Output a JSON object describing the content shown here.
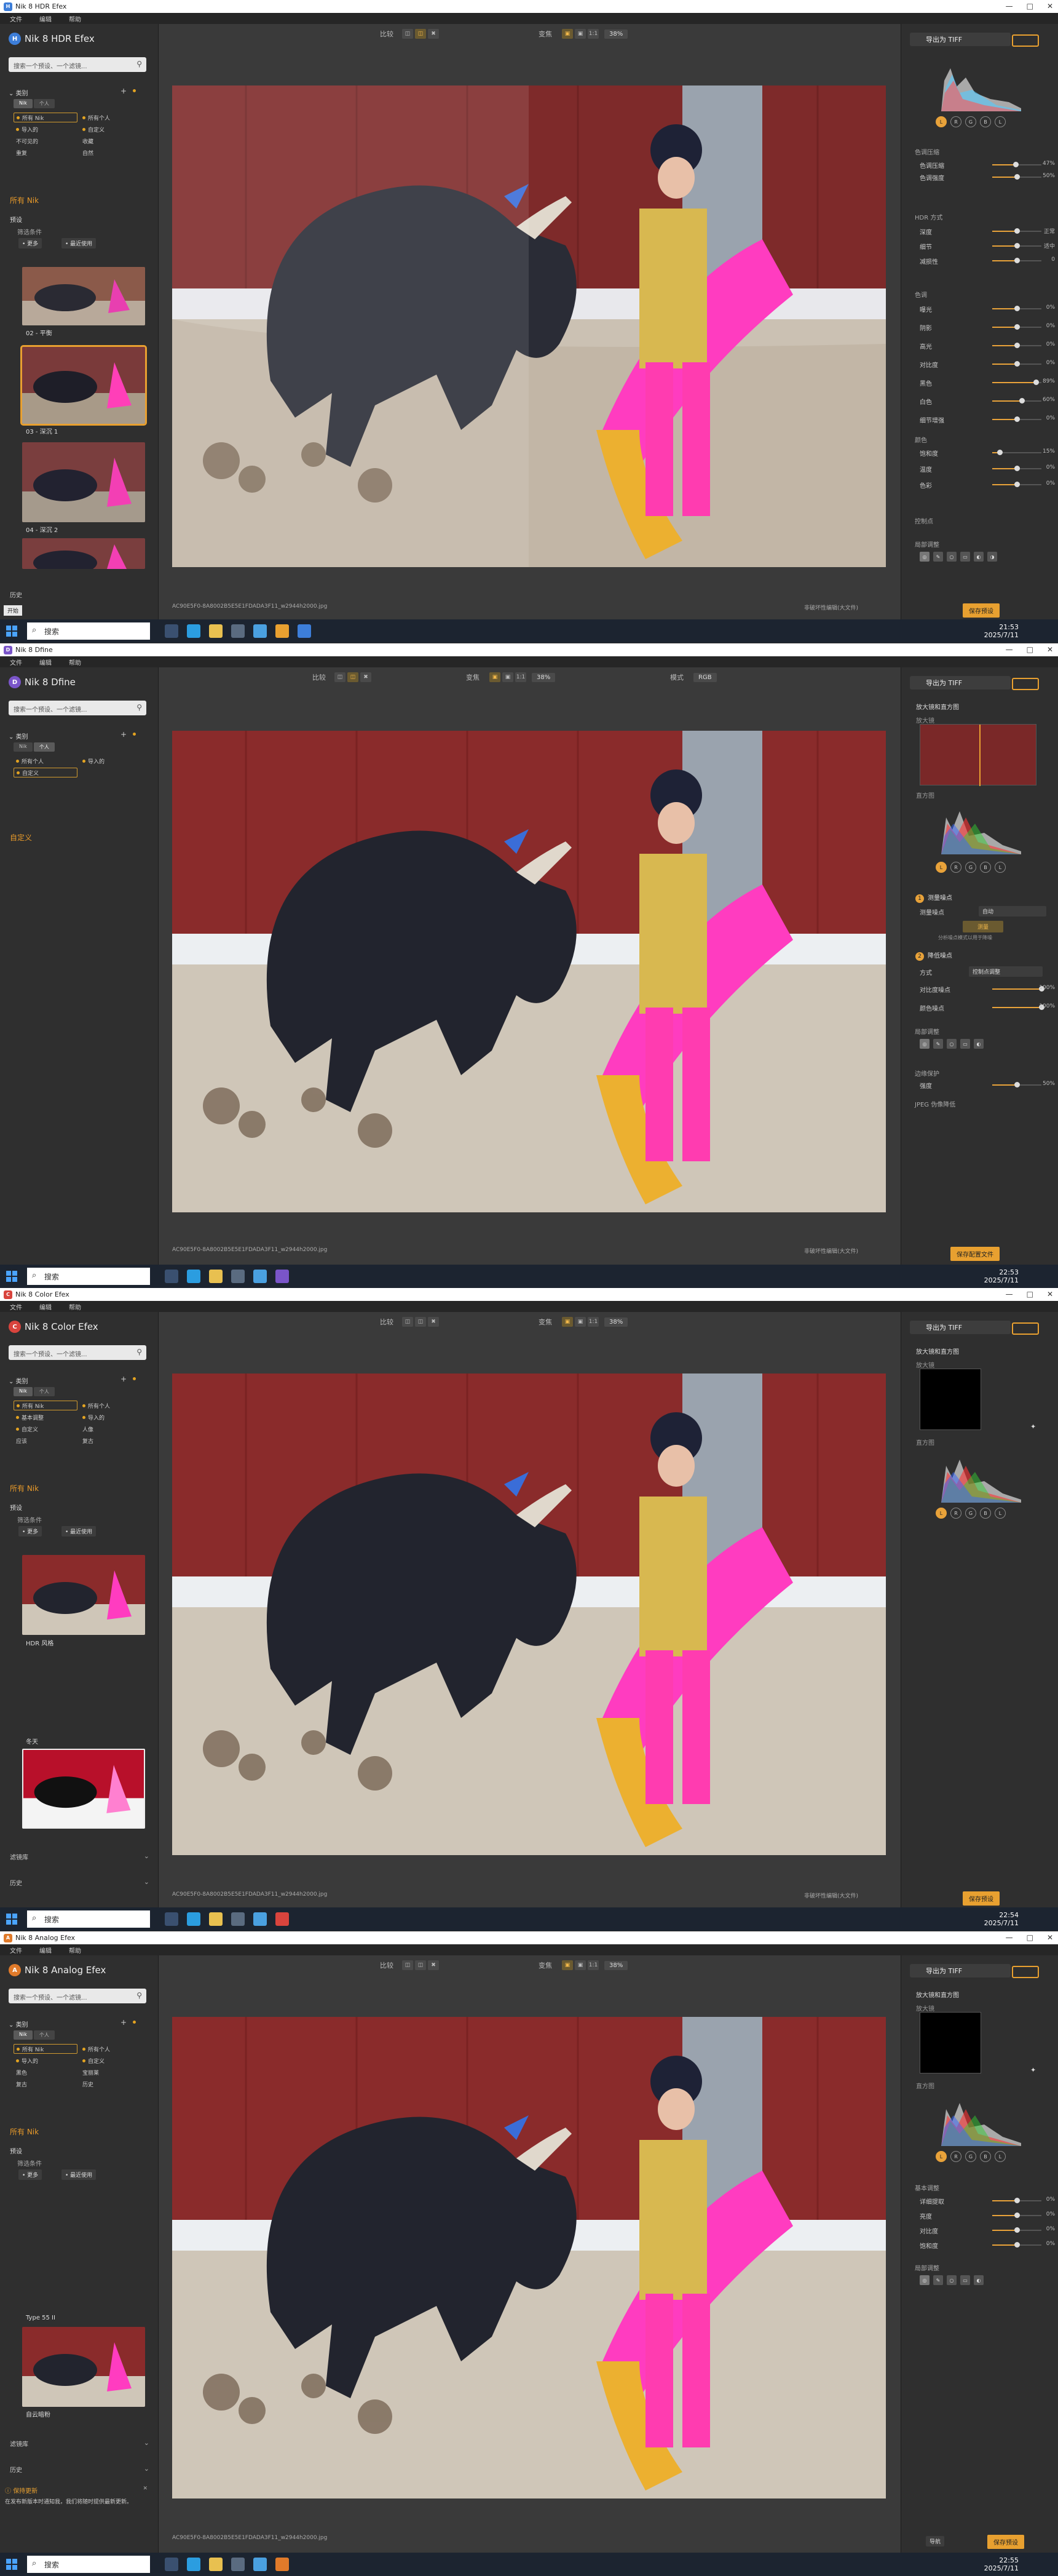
{
  "menu": [
    "文件",
    "编辑",
    "帮助"
  ],
  "search_placeholder": "搜索一个预设、一个滤镜...",
  "common": {
    "compare_label": "比较",
    "view_label": "变焦",
    "zoom_value": "38%",
    "ratio_label": "1:1",
    "export_label": "导出为 TIFF",
    "seg_nik": "Nik",
    "seg_personal": "个人",
    "taskbar_search": "搜索",
    "nondestructive": "非破坏性编辑(大文件)",
    "filename": "AC90E5F0-8A8002B5E5E1FDADA3F11_w2944h2000.jpg",
    "favorites_label": "类别",
    "date": "2025/7/11"
  },
  "windows": [
    {
      "app_title": "Nik 8 HDR Efex",
      "window_title": "Nik 8 HDR Efex",
      "app_letter": "H",
      "accent": "#3d7ed9",
      "categories_left": [
        "所有 Nik",
        "导入的",
        "不可见的",
        "重复"
      ],
      "categories_right": [
        "所有个人",
        "自定义",
        "收藏",
        "自然"
      ],
      "section_label": "所有 Nik",
      "presets_label": "预设",
      "filter_label": "筛选条件",
      "tags": [
        "• 更多",
        "• 最近使用"
      ],
      "thumbs": [
        "02 - 平衡",
        "03 - 深沉 1",
        "04 - 深沉 2"
      ],
      "history_label": "历史",
      "tooltip": "开始",
      "time": "21:53",
      "right_sections": {
        "tone_comp": "色调压缩",
        "tone_rows": [
          [
            "色调压缩",
            "47%"
          ],
          [
            "色调强度",
            "50%"
          ]
        ],
        "hdr_method": "HDR 方式",
        "hdr_rows": [
          [
            "深度",
            "正常"
          ],
          [
            "细节",
            "适中"
          ],
          [
            "减损性",
            "0"
          ]
        ],
        "tone": "色调",
        "tone_rows2": [
          [
            "曝光",
            "0%"
          ],
          [
            "阴影",
            "0%"
          ],
          [
            "高光",
            "0%"
          ],
          [
            "对比度",
            "0%"
          ],
          [
            "黑色",
            "89%"
          ],
          [
            "白色",
            "60%"
          ],
          [
            "细节增强",
            "0%"
          ]
        ],
        "color": "颜色",
        "color_rows": [
          [
            "饱和度",
            "15%"
          ],
          [
            "温度",
            "0%"
          ],
          [
            "色彩",
            "0%"
          ]
        ],
        "control_points": "控制点",
        "local_adjust": "局部调整"
      },
      "save_label": "保存预设"
    },
    {
      "app_title": "Nik 8 Dfine",
      "window_title": "Nik 8 Dfine",
      "app_letter": "D",
      "accent": "#7a55c9",
      "mode_label": "模式",
      "mode_value": "RGB",
      "categories_left": [
        "所有个人",
        "自定义"
      ],
      "categories_right": [
        "导入的"
      ],
      "section_label": "自定义",
      "loupe_title": "放大镜和直方图",
      "loupe_label": "放大镜",
      "hist_label": "直方图",
      "step1": "测量噪点",
      "step1_field_label": "测量噪点",
      "step1_field_value": "自动",
      "step1_btn": "测量",
      "step1_note": "分析噪点模式以用于降噪",
      "step2": "降低噪点",
      "method_label": "方式",
      "method_value": "控制点调整",
      "rows": [
        [
          "对比度噪点",
          "100%"
        ],
        [
          "颜色噪点",
          "100%"
        ]
      ],
      "local_adjust": "局部调整",
      "output_label": "边缘保护",
      "output_row": [
        "强度",
        "50%"
      ],
      "jpeg_label": "JPEG 伪像降低",
      "time": "22:53",
      "save_label": "保存配置文件"
    },
    {
      "app_title": "Nik 8 Color Efex",
      "window_title": "Nik 8 Color Efex",
      "app_letter": "C",
      "accent": "#d9443d",
      "categories_left": [
        "所有 Nik",
        "基本调整",
        "自定义",
        "应该"
      ],
      "categories_right": [
        "所有个人",
        "导入的",
        "人像",
        "复古"
      ],
      "section_label": "所有 Nik",
      "presets_label": "预设",
      "filter_label": "筛选条件",
      "tags": [
        "• 更多",
        "• 最近使用"
      ],
      "thumbs": [
        "HDR 风格",
        "冬天"
      ],
      "edit_stack": "滤镜库",
      "history_label": "历史",
      "loupe_title": "放大镜和直方图",
      "loupe_label": "放大镜",
      "hist_label": "直方图",
      "time": "22:54",
      "save_label": "保存预设"
    },
    {
      "app_title": "Nik 8 Analog Efex",
      "window_title": "Nik 8 Analog Efex",
      "app_letter": "A",
      "accent": "#e07a2a",
      "categories_left": [
        "所有 Nik",
        "导入的",
        "黑色",
        "复古"
      ],
      "categories_right": [
        "所有个人",
        "自定义",
        "宝丽莱",
        "历史"
      ],
      "section_label": "所有 Nik",
      "presets_label": "预设",
      "filter_label": "筛选条件",
      "tags": [
        "• 更多",
        "• 最近使用"
      ],
      "thumbs": [
        "Type 55 II",
        "自云暗粉"
      ],
      "edit_stack": "滤镜库",
      "history_label": "历史",
      "notice_title": "保持更新",
      "notice_text": "在发布新版本时通知我，我们将随时提供最新更新。",
      "loupe_title": "放大镜和直方图",
      "loupe_label": "放大镜",
      "hist_label": "直方图",
      "basic": "基本调整",
      "basic_rows": [
        [
          "详细提取",
          "0%"
        ],
        [
          "亮度",
          "0%"
        ],
        [
          "对比度",
          "0%"
        ],
        [
          "饱和度",
          "0%"
        ]
      ],
      "local_adjust": "局部调整",
      "time": "22:55",
      "bottom_btn1": "导航",
      "save_label": "保存预设"
    }
  ]
}
